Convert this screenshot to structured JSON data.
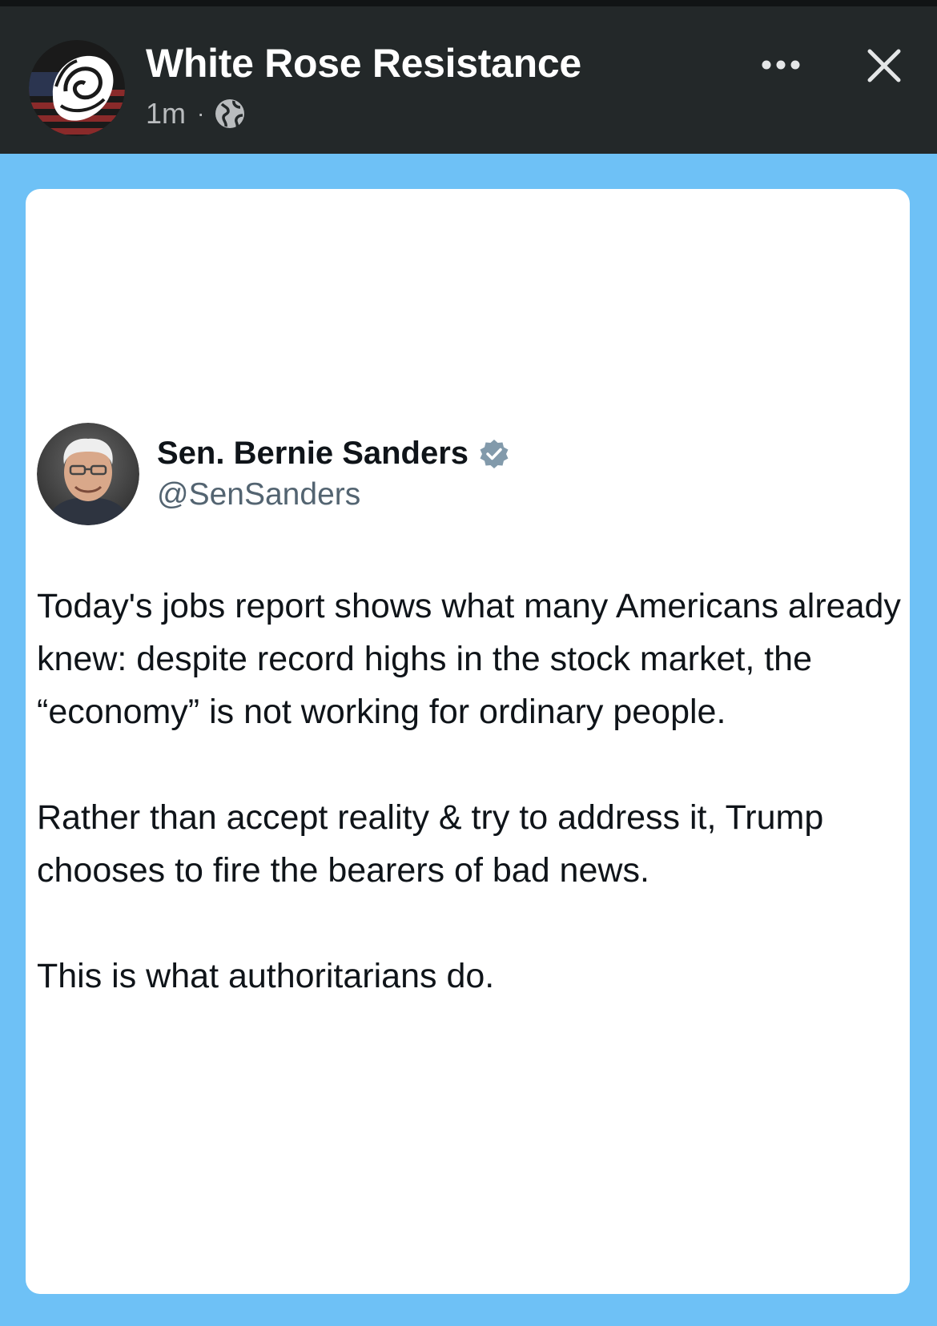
{
  "header": {
    "page_name": "White Rose Resistance",
    "timestamp": "1m",
    "separator": "·",
    "privacy_icon": "globe-icon",
    "more_icon": "more-dots-icon",
    "close_icon": "close-icon",
    "avatar_icon": "white-rose-logo"
  },
  "post": {
    "background_color": "#6ec1f6",
    "tweet": {
      "author_name": "Sen. Bernie Sanders",
      "handle": "@SenSanders",
      "verified_icon": "verified-badge-icon",
      "paragraphs": [
        "Today's jobs report shows what many Americans already knew: despite record highs in the stock market, the “economy” is not working for ordinary people.",
        "Rather than accept reality & try to address it, Trump chooses to fire the bearers of bad news.",
        "This is what authoritarians do."
      ]
    }
  }
}
